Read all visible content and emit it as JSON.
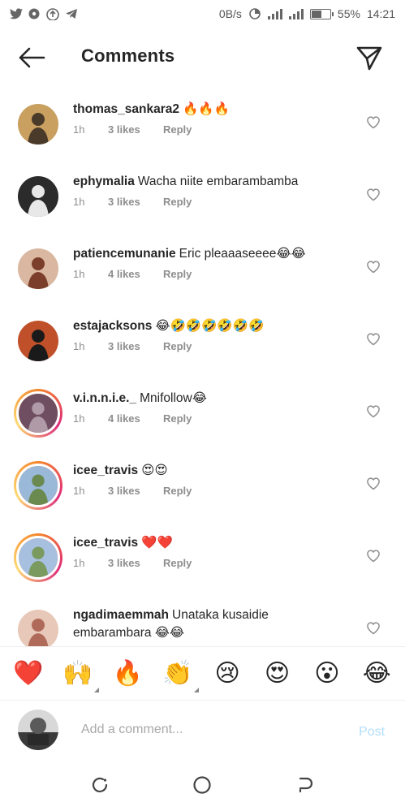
{
  "status_bar": {
    "net_speed": "0B/s",
    "battery_percent": "55%",
    "battery_level": 0.55,
    "time": "14:21",
    "left_icons": [
      "twitter-icon",
      "messenger-icon",
      "cloud-upload-icon",
      "telegram-icon"
    ]
  },
  "header": {
    "title": "Comments",
    "back_icon": "arrow-left-icon",
    "send_icon": "paper-plane-icon"
  },
  "comments": [
    {
      "username": "thomas_sankara2",
      "text": "🔥🔥🔥",
      "time": "1h",
      "likes": "3 likes",
      "reply": "Reply",
      "story_ring": false,
      "avatar_colors": [
        "#4a3a2a",
        "#c9a060"
      ]
    },
    {
      "username": "ephymalia",
      "text": "Wacha niite embarambamba",
      "time": "1h",
      "likes": "3 likes",
      "reply": "Reply",
      "story_ring": false,
      "avatar_colors": [
        "#e8e8e8",
        "#2b2b2b"
      ]
    },
    {
      "username": "patiencemunanie",
      "text": "Eric pleaaaseeee😂😂",
      "time": "1h",
      "likes": "4 likes",
      "reply": "Reply",
      "story_ring": false,
      "avatar_colors": [
        "#7a3e2a",
        "#d9b7a0"
      ]
    },
    {
      "username": "estajacksons",
      "text": "😂🤣🤣🤣🤣🤣🤣",
      "time": "1h",
      "likes": "3 likes",
      "reply": "Reply",
      "story_ring": false,
      "avatar_colors": [
        "#1a1a1a",
        "#c0502a"
      ]
    },
    {
      "username": "v.i.n.n.i.e._",
      "text": "Mnifollow😂",
      "time": "1h",
      "likes": "4 likes",
      "reply": "Reply",
      "story_ring": true,
      "avatar_colors": [
        "#b09aa8",
        "#6e4e60"
      ]
    },
    {
      "username": "icee_travis",
      "text": "😍😍",
      "time": "1h",
      "likes": "3 likes",
      "reply": "Reply",
      "story_ring": true,
      "avatar_colors": [
        "#6a8a50",
        "#9ab8d8"
      ]
    },
    {
      "username": "icee_travis",
      "text": "❤️❤️",
      "time": "1h",
      "likes": "3 likes",
      "reply": "Reply",
      "story_ring": true,
      "avatar_colors": [
        "#7a9a60",
        "#a8c0e0"
      ]
    },
    {
      "username": "ngadimaemmah",
      "text": "Unataka kusaidie embarambara 😂😂",
      "time": "",
      "likes": "",
      "reply": "",
      "story_ring": false,
      "avatar_colors": [
        "#b06a5a",
        "#e8c8b8"
      ]
    }
  ],
  "like_icon": "heart-outline-icon",
  "reactions": [
    {
      "emoji": "❤️",
      "name": "red-heart-emoji",
      "has_variants": false
    },
    {
      "emoji": "🙌",
      "name": "raising-hands-emoji",
      "has_variants": true
    },
    {
      "emoji": "🔥",
      "name": "fire-emoji",
      "has_variants": false
    },
    {
      "emoji": "👏",
      "name": "clapping-hands-emoji",
      "has_variants": true
    },
    {
      "emoji": "😢",
      "name": "crying-face-emoji",
      "has_variants": false
    },
    {
      "emoji": "😍",
      "name": "heart-eyes-emoji",
      "has_variants": false
    },
    {
      "emoji": "😮",
      "name": "surprised-face-emoji",
      "has_variants": false
    },
    {
      "emoji": "😂",
      "name": "tears-of-joy-emoji",
      "has_variants": false
    }
  ],
  "composer": {
    "placeholder": "Add a comment...",
    "post_label": "Post"
  },
  "nav_bar": {
    "icons": [
      "recent-apps-icon",
      "home-icon",
      "back-icon"
    ]
  },
  "colors": {
    "text": "#262626",
    "secondary": "#8e8e8e",
    "post_disabled": "#b2dffc",
    "story_ring": [
      "#f58529",
      "#dd2a7b",
      "#feda75"
    ]
  }
}
